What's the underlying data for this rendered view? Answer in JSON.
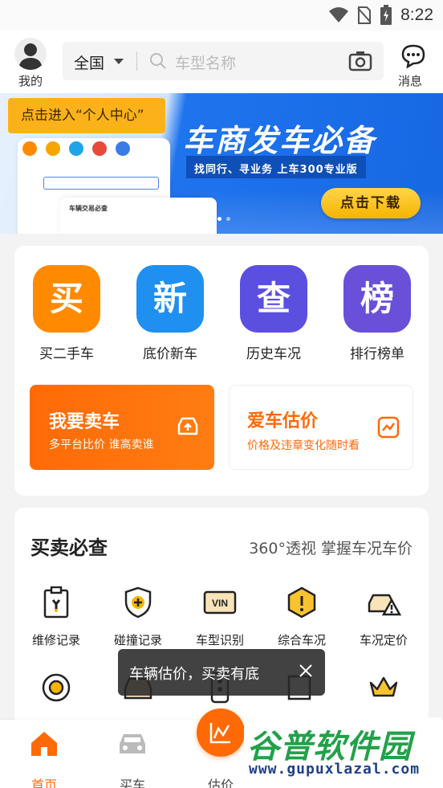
{
  "status": {
    "time": "8:22"
  },
  "topbar": {
    "profile_label": "我的",
    "city": "全国",
    "search_placeholder": "车型名称",
    "messages_label": "消息"
  },
  "banner": {
    "tooltip": "点击进入“个人中心”",
    "title": "车商发车必备",
    "subtitle": "找同行、寻业务  上车300专业版",
    "cta": "点击下载",
    "mock_card_title": "车辆交易必查",
    "page": 2,
    "pages": 3
  },
  "features": [
    {
      "glyph": "买",
      "label": "买二手车",
      "color": "#ff8a00",
      "icon": "buy-icon"
    },
    {
      "glyph": "新",
      "label": "底价新车",
      "color": "#1f8ff0",
      "icon": "new-car-icon"
    },
    {
      "glyph": "查",
      "label": "历史车况",
      "color": "#5b4fe0",
      "icon": "history-icon"
    },
    {
      "glyph": "榜",
      "label": "排行榜单",
      "color": "#6a4fd8",
      "icon": "ranking-icon"
    }
  ],
  "promo": {
    "sell": {
      "title": "我要卖车",
      "subtitle": "多平台比价 谁高卖谁"
    },
    "value": {
      "title": "爱车估价",
      "subtitle": "价格及违章变化随时看"
    }
  },
  "section": {
    "title": "买卖必查",
    "subtitle": "360°透视 掌握车况车价",
    "tools": [
      {
        "label": "维修记录",
        "icon": "repair-record-icon"
      },
      {
        "label": "碰撞记录",
        "icon": "collision-record-icon"
      },
      {
        "label": "车型识别",
        "icon": "vin-icon"
      },
      {
        "label": "综合车况",
        "icon": "condition-icon"
      },
      {
        "label": "车况定价",
        "icon": "pricing-icon"
      }
    ]
  },
  "toast": {
    "text": "车辆估价，买卖有底"
  },
  "nav": {
    "home": "首页",
    "buy": "买车",
    "estimate": "估价"
  },
  "watermark": {
    "title": "谷普软件园",
    "url": "www.gupuxlazal.com"
  },
  "colors": {
    "accent": "#ff6a07",
    "banner_blue": "#1767e3"
  }
}
